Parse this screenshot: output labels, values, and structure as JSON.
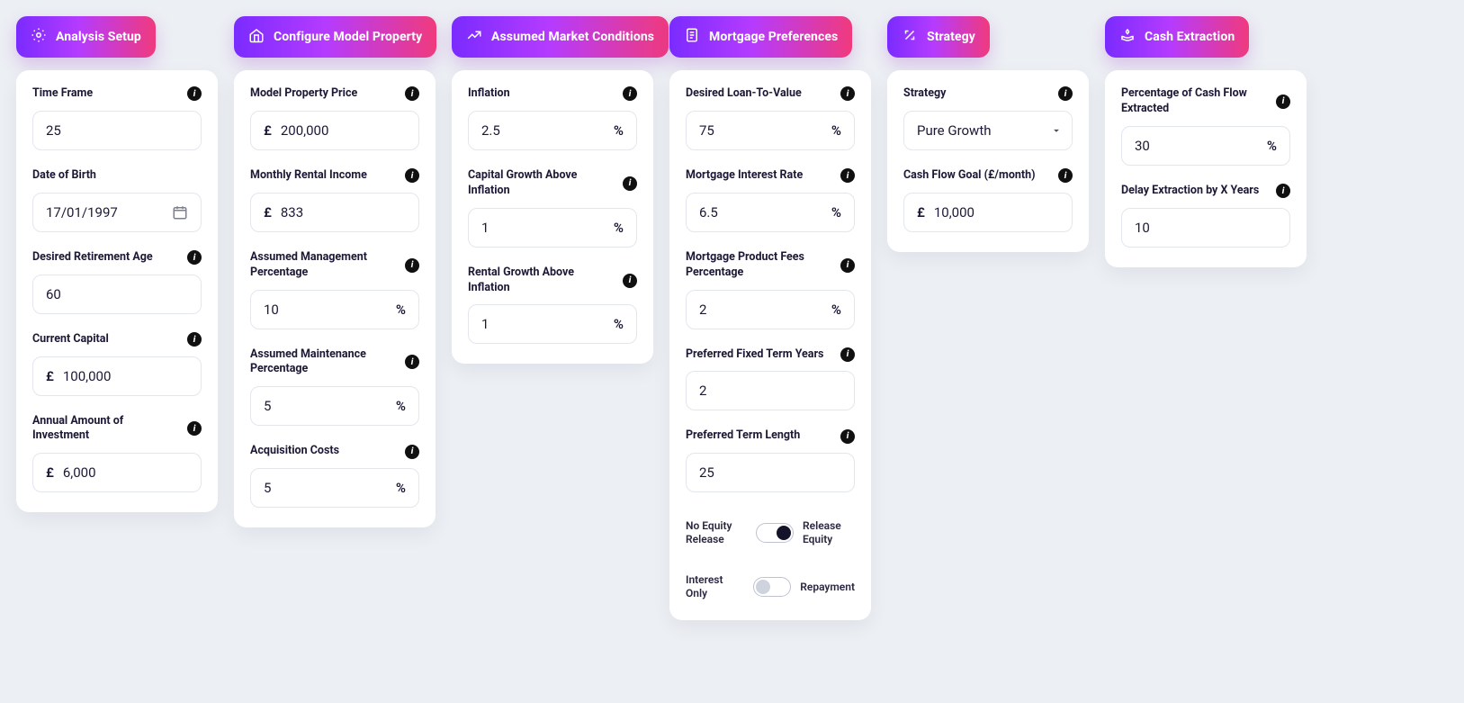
{
  "analysis": {
    "title": "Analysis Setup",
    "time_frame": {
      "label": "Time Frame",
      "value": "25"
    },
    "dob": {
      "label": "Date of Birth",
      "value": "17/01/1997"
    },
    "retire_age": {
      "label": "Desired Retirement Age",
      "value": "60"
    },
    "capital": {
      "label": "Current Capital",
      "value": "100,000",
      "prefix": "£"
    },
    "annual_inv": {
      "label": "Annual Amount of Investment",
      "value": "6,000",
      "prefix": "£"
    }
  },
  "property": {
    "title": "Configure Model Property",
    "price": {
      "label": "Model Property Price",
      "value": "200,000",
      "prefix": "£"
    },
    "rent": {
      "label": "Monthly Rental Income",
      "value": "833",
      "prefix": "£"
    },
    "mgmt_pct": {
      "label": "Assumed Management Percentage",
      "value": "10",
      "suffix": "%"
    },
    "maint_pct": {
      "label": "Assumed Maintenance Percentage",
      "value": "5",
      "suffix": "%"
    },
    "acq_pct": {
      "label": "Acquisition Costs",
      "value": "5",
      "suffix": "%"
    }
  },
  "market": {
    "title": "Assumed Market Conditions",
    "inflation": {
      "label": "Inflation",
      "value": "2.5",
      "suffix": "%"
    },
    "cap_growth": {
      "label": "Capital Growth Above Inflation",
      "value": "1",
      "suffix": "%"
    },
    "rent_growth": {
      "label": "Rental Growth Above Inflation",
      "value": "1",
      "suffix": "%"
    }
  },
  "mortgage": {
    "title": "Mortgage Preferences",
    "ltv": {
      "label": "Desired Loan-To-Value",
      "value": "75",
      "suffix": "%"
    },
    "rate": {
      "label": "Mortgage Interest Rate",
      "value": "6.5",
      "suffix": "%"
    },
    "fees": {
      "label": "Mortgage Product Fees Percentage",
      "value": "2",
      "suffix": "%"
    },
    "fix_years": {
      "label": "Preferred Fixed Term Years",
      "value": "2"
    },
    "term_len": {
      "label": "Preferred Term Length",
      "value": "25"
    },
    "equity_toggle": {
      "left": "No Equity Release",
      "right": "Release Equity",
      "on": true
    },
    "repay_toggle": {
      "left": "Interest Only",
      "right": "Repayment",
      "on": false
    }
  },
  "strategy": {
    "title": "Strategy",
    "strategy": {
      "label": "Strategy",
      "value": "Pure Growth"
    },
    "goal": {
      "label": "Cash Flow Goal (£/month)",
      "value": "10,000",
      "prefix": "£"
    }
  },
  "cash": {
    "title": "Cash Extraction",
    "pct": {
      "label": "Percentage of Cash Flow Extracted",
      "value": "30",
      "suffix": "%"
    },
    "delay": {
      "label": "Delay Extraction by X Years",
      "value": "10"
    }
  }
}
